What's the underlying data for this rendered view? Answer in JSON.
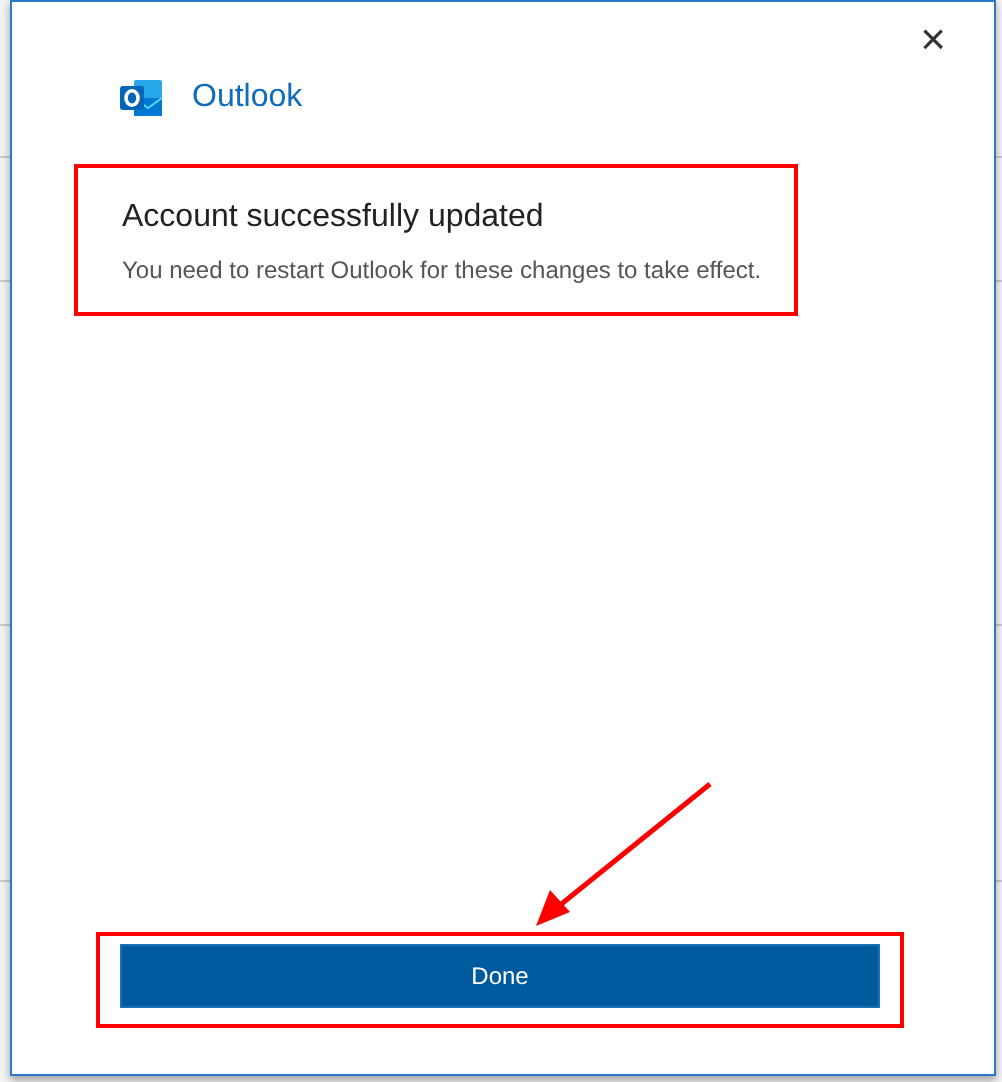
{
  "dialog": {
    "close_glyph": "×",
    "app_name": "Outlook"
  },
  "message": {
    "title": "Account successfully updated",
    "body": "You need to restart Outlook for these changes to take effect."
  },
  "buttons": [
    {
      "label": "Done"
    }
  ]
}
